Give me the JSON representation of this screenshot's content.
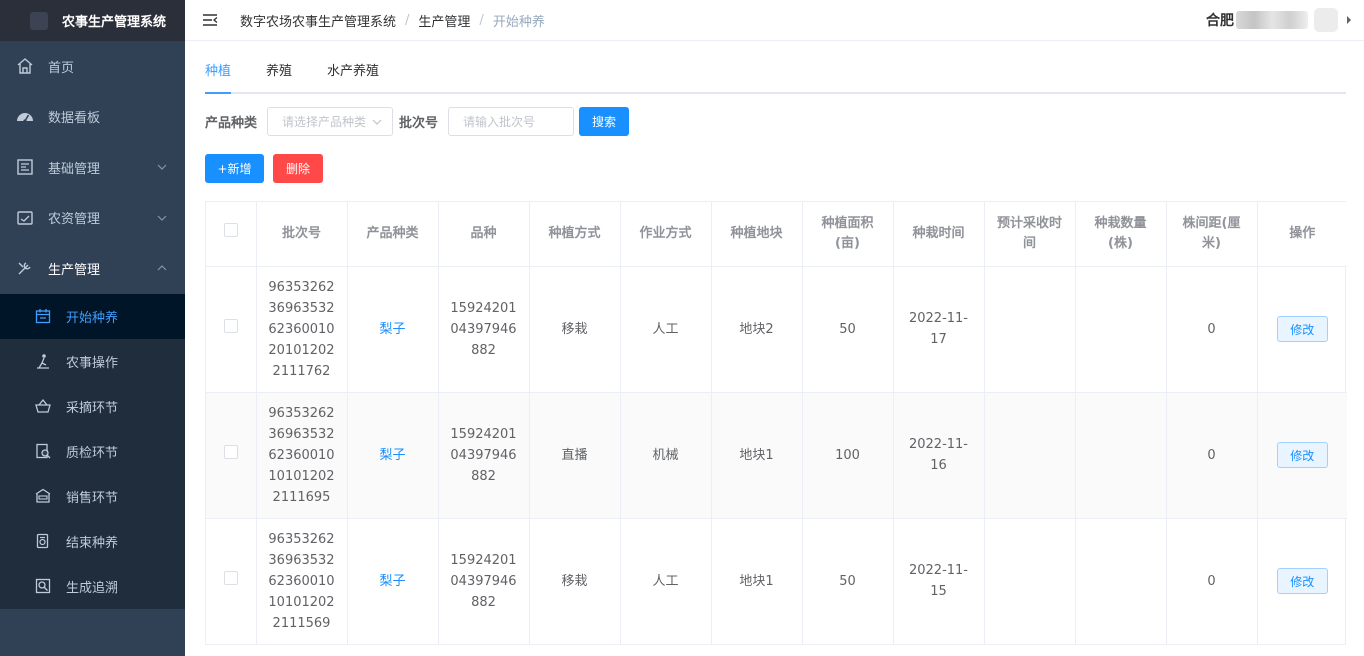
{
  "app": {
    "title": "农事生产管理系统"
  },
  "sidebar": {
    "items": [
      {
        "label": "首页",
        "icon": "home-icon"
      },
      {
        "label": "数据看板",
        "icon": "dashboard-icon"
      },
      {
        "label": "基础管理",
        "icon": "basic-manage-icon"
      },
      {
        "label": "农资管理",
        "icon": "supplies-icon"
      },
      {
        "label": "生产管理",
        "icon": "production-icon"
      }
    ],
    "sub_items": [
      {
        "label": "开始种养",
        "icon": "calendar-icon",
        "active": true
      },
      {
        "label": "农事操作",
        "icon": "farm-operation-icon"
      },
      {
        "label": "采摘环节",
        "icon": "basket-icon"
      },
      {
        "label": "质检环节",
        "icon": "inspection-icon"
      },
      {
        "label": "销售环节",
        "icon": "shop-icon"
      },
      {
        "label": "结束种养",
        "icon": "finish-icon"
      },
      {
        "label": "生成追溯",
        "icon": "trace-icon"
      }
    ]
  },
  "header": {
    "breadcrumb": [
      "数字农场农事生产管理系统",
      "生产管理",
      "开始种养"
    ],
    "user_name": "合肥"
  },
  "tabs": [
    "种植",
    "养殖",
    "水产养殖"
  ],
  "filters": {
    "product_type_label": "产品种类",
    "product_type_placeholder": "请选择产品种类",
    "batch_label": "批次号",
    "batch_placeholder": "请输入批次号",
    "search_label": "搜索"
  },
  "actions": {
    "add_label": "+新增",
    "delete_label": "删除"
  },
  "table": {
    "columns": [
      "批次号",
      "产品种类",
      "品种",
      "种植方式",
      "作业方式",
      "种植地块",
      "种植面积(亩)",
      "种栽时间",
      "预计采收时间",
      "种栽数量(株)",
      "株间距(厘米)",
      "操作"
    ],
    "rows": [
      {
        "batch": "963532623696353262360010201012022111762",
        "product": "梨子",
        "variety": "1592420104397946882",
        "method": "移栽",
        "operation": "人工",
        "plot": "地块2",
        "area": "50",
        "date": "2022-11-17",
        "harvest": "",
        "count": "",
        "spacing": "0",
        "edit": "修改"
      },
      {
        "batch": "963532623696353262360010101012022111695",
        "product": "梨子",
        "variety": "1592420104397946882",
        "method": "直播",
        "operation": "机械",
        "plot": "地块1",
        "area": "100",
        "date": "2022-11-16",
        "harvest": "",
        "count": "",
        "spacing": "0",
        "edit": "修改"
      },
      {
        "batch": "963532623696353262360010101012022111569",
        "product": "梨子",
        "variety": "1592420104397946882",
        "method": "移栽",
        "operation": "人工",
        "plot": "地块1",
        "area": "50",
        "date": "2022-11-15",
        "harvest": "",
        "count": "",
        "spacing": "0",
        "edit": "修改"
      }
    ]
  },
  "colors": {
    "primary": "#1890ff",
    "danger": "#ff4949",
    "sidebar_bg": "#304156",
    "sidebar_active_bg": "#001528",
    "logo_bg": "#2b2f3a"
  }
}
